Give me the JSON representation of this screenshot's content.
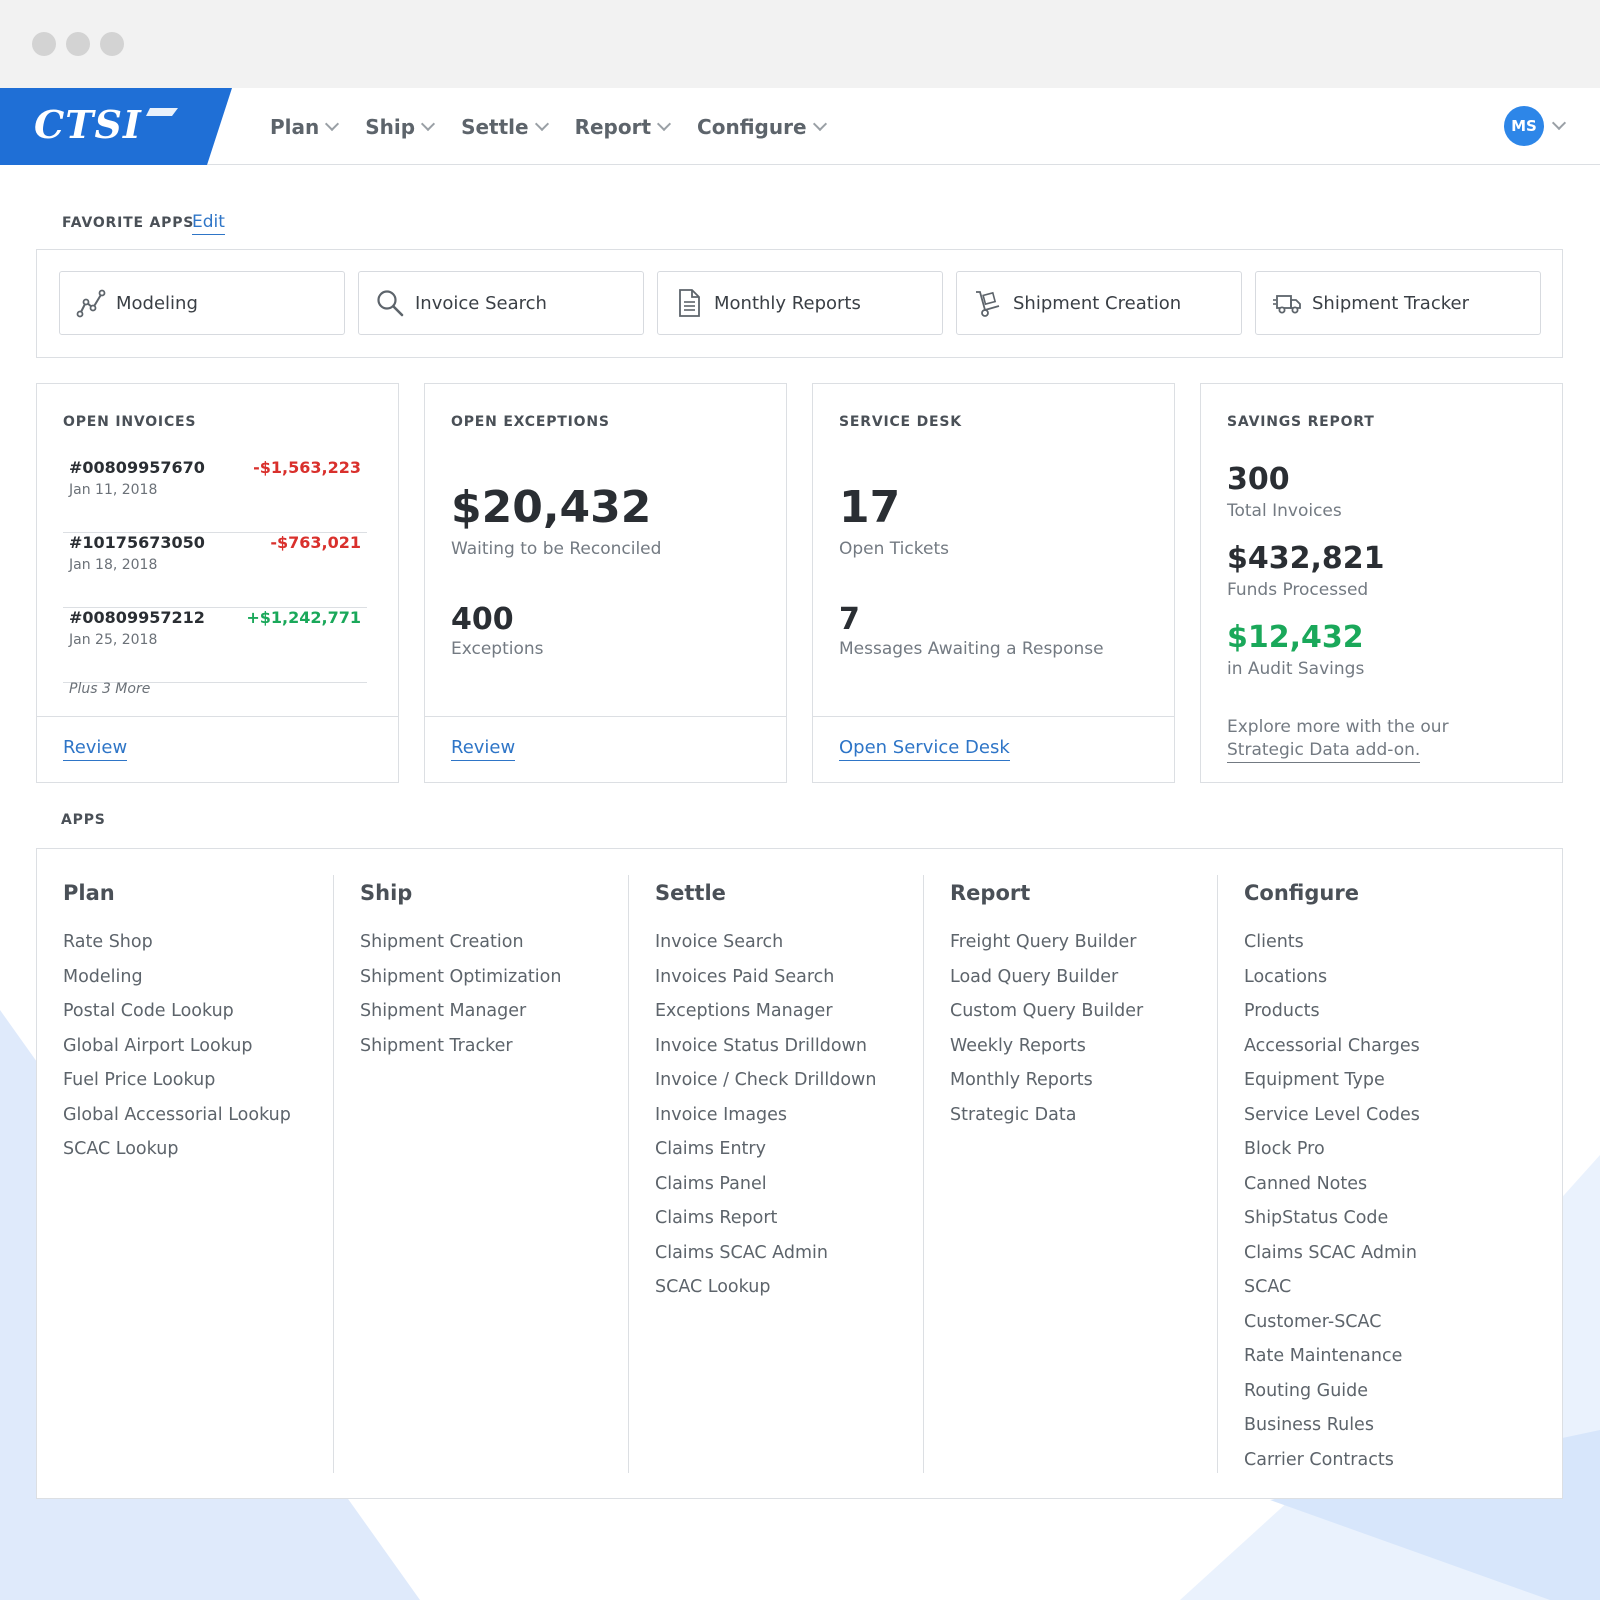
{
  "window": {
    "controls": [
      "close",
      "minimize",
      "maximize"
    ]
  },
  "brand": {
    "logo_text": "CTSI",
    "color": "#1f6fd6"
  },
  "nav": {
    "items": [
      {
        "label": "Plan"
      },
      {
        "label": "Ship"
      },
      {
        "label": "Settle"
      },
      {
        "label": "Report"
      },
      {
        "label": "Configure"
      }
    ],
    "user_initials": "MS",
    "avatar_color": "#2d86e8"
  },
  "favorites": {
    "title": "FAVORITE APPS",
    "edit_label": "Edit",
    "tiles": [
      {
        "label": "Modeling",
        "icon": "modeling-icon"
      },
      {
        "label": "Invoice Search",
        "icon": "search-icon"
      },
      {
        "label": "Monthly Reports",
        "icon": "document-icon"
      },
      {
        "label": "Shipment Creation",
        "icon": "hand-truck-icon"
      },
      {
        "label": "Shipment Tracker",
        "icon": "truck-icon"
      }
    ]
  },
  "open_invoices": {
    "title": "OPEN INVOICES",
    "rows": [
      {
        "number": "#00809957670",
        "date": "Jan 11, 2018",
        "amount": "-$1,563,223",
        "status": "negative"
      },
      {
        "number": "#10175673050",
        "date": "Jan 18, 2018",
        "amount": "-$763,021",
        "status": "negative"
      },
      {
        "number": "#00809957212",
        "date": "Jan 25, 2018",
        "amount": "+$1,242,771",
        "status": "positive"
      }
    ],
    "more": "Plus 3 More",
    "link": "Review"
  },
  "open_exceptions": {
    "title": "OPEN EXCEPTIONS",
    "primary_value": "$20,432",
    "primary_label": "Waiting to be Reconciled",
    "secondary_value": "400",
    "secondary_label": "Exceptions",
    "link": "Review"
  },
  "service_desk": {
    "title": "SERVICE DESK",
    "primary_value": "17",
    "primary_label": "Open Tickets",
    "secondary_value": "7",
    "secondary_label": "Messages Awaiting a Response",
    "link": "Open Service Desk"
  },
  "savings_report": {
    "title": "SAVINGS REPORT",
    "stats": [
      {
        "value": "300",
        "label": "Total Invoices"
      },
      {
        "value": "$432,821",
        "label": "Funds Processed"
      },
      {
        "value": "$12,432",
        "label": "in Audit Savings"
      }
    ],
    "promo_line1": "Explore more with the our",
    "promo_link": "Strategic Data add-on."
  },
  "apps": {
    "title": "APPS",
    "columns": [
      {
        "heading": "Plan",
        "items": [
          "Rate Shop",
          "Modeling",
          "Postal Code Lookup",
          "Global Airport Lookup",
          "Fuel Price Lookup",
          "Global Accessorial Lookup",
          "SCAC Lookup"
        ]
      },
      {
        "heading": "Ship",
        "items": [
          "Shipment Creation",
          "Shipment Optimization",
          "Shipment Manager",
          "Shipment Tracker"
        ]
      },
      {
        "heading": "Settle",
        "items": [
          "Invoice Search",
          "Invoices Paid Search",
          "Exceptions Manager",
          "Invoice Status Drilldown",
          "Invoice / Check Drilldown",
          "Invoice Images",
          "Claims Entry",
          "Claims Panel",
          "Claims Report",
          "Claims SCAC Admin",
          "SCAC Lookup"
        ]
      },
      {
        "heading": "Report",
        "items": [
          "Freight Query Builder",
          "Load Query Builder",
          "Custom Query Builder",
          "Weekly Reports",
          "Monthly Reports",
          "Strategic Data"
        ]
      },
      {
        "heading": "Configure",
        "items": [
          "Clients",
          "Locations",
          "Products",
          "Accessorial Charges",
          "Equipment Type",
          "Service Level Codes",
          "Block Pro",
          "Canned Notes",
          "ShipStatus Code",
          "Claims SCAC Admin",
          "SCAC",
          "Customer-SCAC",
          "Rate Maintenance",
          "Routing Guide",
          "Business Rules",
          "Carrier Contracts"
        ]
      }
    ]
  },
  "colors": {
    "link": "#2e75c7",
    "negative": "#d9302c",
    "positive": "#1aa85a"
  }
}
